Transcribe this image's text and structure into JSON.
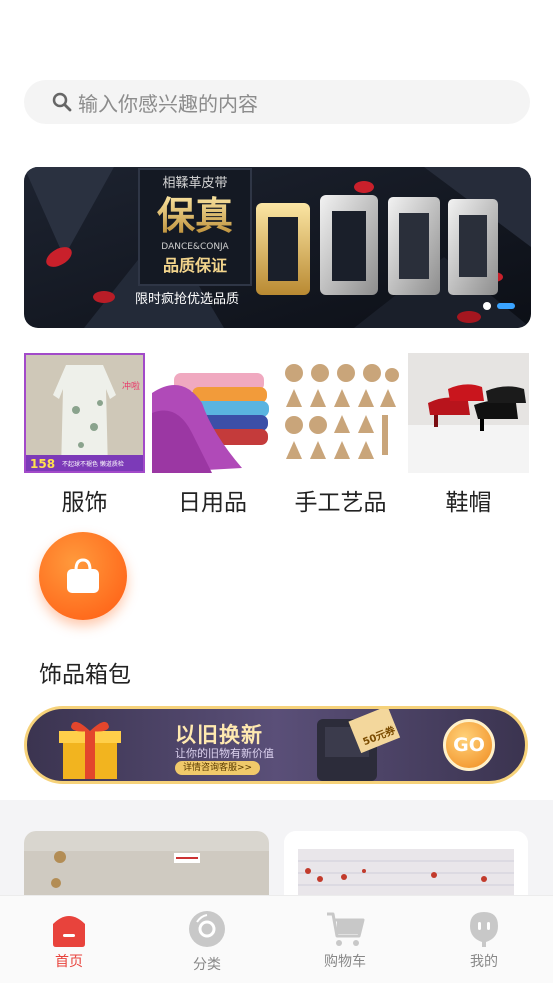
{
  "search": {
    "placeholder": "输入你感兴趣的内容",
    "icon": "search-icon"
  },
  "banner": {
    "headline_small": "相鞣革皮带",
    "headline_big": "保真",
    "brand": "DANCE&CONJA",
    "quality": "品质保证",
    "footer": "限时疯抢优选品质",
    "page_count": 2,
    "active_page": 2
  },
  "categories": [
    {
      "label": "服饰",
      "price": "158",
      "note": "不起球不褪色 懒道质检",
      "tag": "冲啦"
    },
    {
      "label": "日用品"
    },
    {
      "label": "手工艺品"
    },
    {
      "label": "鞋帽"
    },
    {
      "label": "饰品箱包",
      "icon": "shopping-bag-icon"
    }
  ],
  "promo": {
    "title": "以旧换新",
    "subtitle": "让你的旧物有新价值",
    "cta": "详情咨询客服>>",
    "coupon": "50元券",
    "go": "GO"
  },
  "tabbar": [
    {
      "label": "首页",
      "icon": "home-icon",
      "active": true
    },
    {
      "label": "分类",
      "icon": "category-icon",
      "active": false
    },
    {
      "label": "购物车",
      "icon": "cart-icon",
      "active": false
    },
    {
      "label": "我的",
      "icon": "profile-icon",
      "active": false
    }
  ],
  "colors": {
    "accent": "#e8433c",
    "orange": "#ff6a1a",
    "tab_inactive": "#888888"
  }
}
